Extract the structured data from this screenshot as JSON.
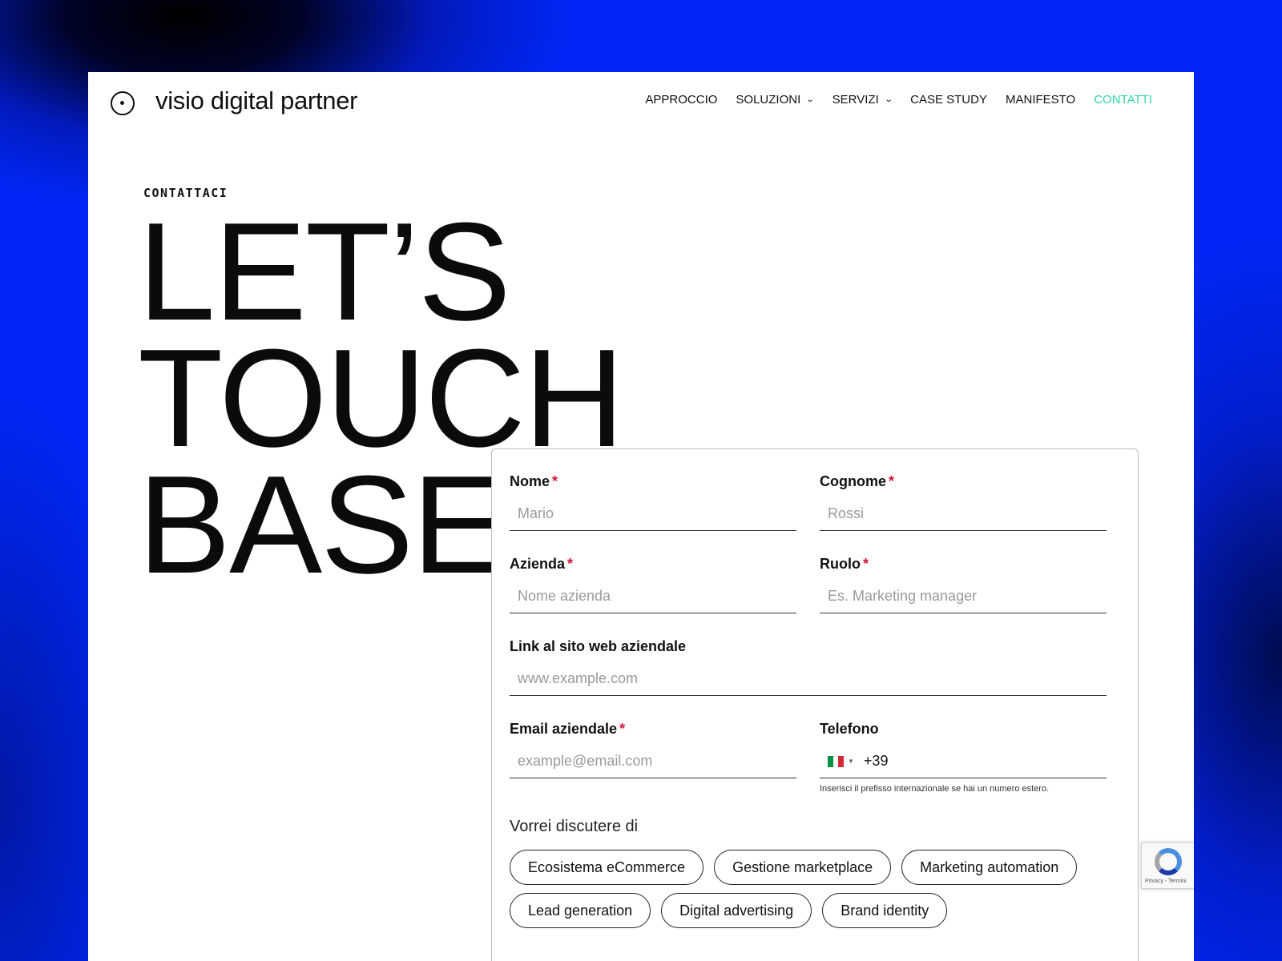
{
  "header": {
    "brand": "visio digital partner",
    "nav": [
      {
        "label": "APPROCCIO",
        "has_dropdown": false,
        "active": false
      },
      {
        "label": "SOLUZIONI",
        "has_dropdown": true,
        "active": false
      },
      {
        "label": "SERVIZI",
        "has_dropdown": true,
        "active": false
      },
      {
        "label": "CASE STUDY",
        "has_dropdown": false,
        "active": false
      },
      {
        "label": "MANIFESTO",
        "has_dropdown": false,
        "active": false
      },
      {
        "label": "CONTATTI",
        "has_dropdown": false,
        "active": true
      }
    ]
  },
  "hero": {
    "eyebrow": "CONTATTACI",
    "headline": [
      "LET’S",
      "TOUCH",
      "BASE"
    ]
  },
  "form": {
    "fields": {
      "nome": {
        "label": "Nome",
        "required": "*",
        "placeholder": "Mario",
        "value": ""
      },
      "cognome": {
        "label": "Cognome",
        "required": "*",
        "placeholder": "Rossi",
        "value": ""
      },
      "azienda": {
        "label": "Azienda",
        "required": "*",
        "placeholder": "Nome azienda",
        "value": ""
      },
      "ruolo": {
        "label": "Ruolo",
        "required": "*",
        "placeholder": "Es. Marketing manager",
        "value": ""
      },
      "sito": {
        "label": "Link al sito web aziendale",
        "placeholder": "www.example.com",
        "value": ""
      },
      "email": {
        "label": "Email aziendale",
        "required": "*",
        "placeholder": "example@email.com",
        "value": ""
      },
      "telefono": {
        "label": "Telefono",
        "prefix": "+39",
        "country_flag": "italy-flag-icon",
        "helper": "Inserisci il prefisso internazionale se hai un numero estero."
      }
    },
    "topics_label": "Vorrei discutere di",
    "topics": [
      "Ecosistema eCommerce",
      "Gestione marketplace",
      "Marketing automation",
      "Lead generation",
      "Digital advertising",
      "Brand identity"
    ]
  },
  "recaptcha": {
    "links": "Privacy - Termini"
  },
  "colors": {
    "background_blue": "#0226f5",
    "nav_active": "#2ed8a3",
    "required_star": "#d4143a",
    "flag": [
      "#009246",
      "#ffffff",
      "#ce2b37"
    ]
  }
}
